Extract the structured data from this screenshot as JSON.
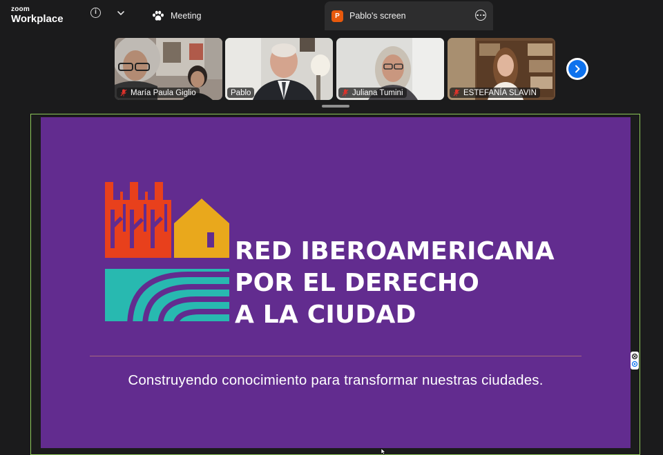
{
  "app": {
    "brand_small": "zoom",
    "brand_big": "Workplace"
  },
  "top_tabs": {
    "meeting_label": "Meeting",
    "share_label": "Pablo's screen",
    "share_badge": "P"
  },
  "participants": [
    {
      "name": "María Paula Giglio",
      "muted": true
    },
    {
      "name": "Pablo",
      "muted": false,
      "active_speaker": true
    },
    {
      "name": "Juliana Tumini",
      "muted": true
    },
    {
      "name": "ESTEFANÍA SLAVIN",
      "muted": true
    }
  ],
  "slide": {
    "title_lines": [
      "RED IBEROAMERICANA",
      "POR EL DERECHO",
      "A LA CIUDAD"
    ],
    "tagline": "Construyendo conocimiento para transformar nuestras ciudades."
  },
  "colors": {
    "slide_background": "#622c8f",
    "logo_red": "#e8401c",
    "logo_yellow": "#e9a81c",
    "logo_teal": "#28b9b0",
    "active_speaker": "#1fd18b",
    "next_button": "#0e72ed",
    "share_badge": "#e8590c"
  },
  "icons": [
    "info-icon",
    "chevron-down-icon",
    "paw-icon",
    "more-options-icon",
    "mic-muted-icon",
    "chevron-right-icon"
  ]
}
